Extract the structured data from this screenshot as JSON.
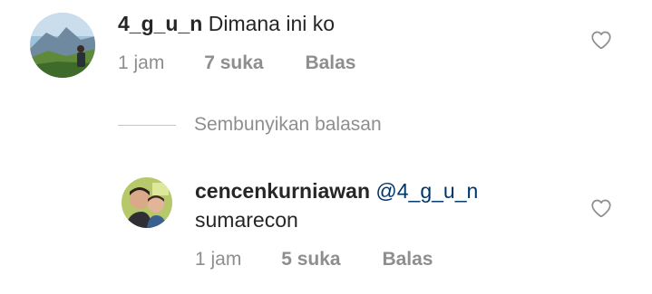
{
  "comment": {
    "username": "4_g_u_n",
    "text": "Dimana ini ko",
    "time": "1 jam",
    "likes": "7 suka",
    "reply_label": "Balas"
  },
  "hide_replies_label": "Sembunyikan balasan",
  "reply": {
    "username": "cencenkurniawan",
    "mention": "@4_g_u_n",
    "text": "sumarecon",
    "time": "1 jam",
    "likes": "5 suka",
    "reply_label": "Balas"
  },
  "icons": {
    "comment_like": "heart-outline-icon",
    "reply_like": "heart-outline-icon"
  }
}
